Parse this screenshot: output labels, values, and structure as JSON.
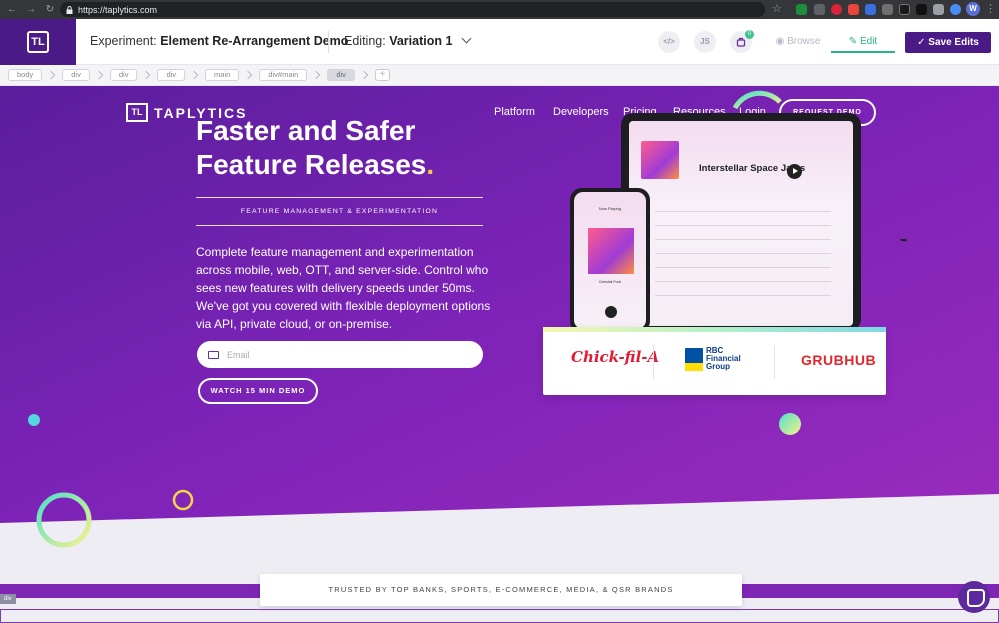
{
  "browser": {
    "url": "https://taplytics.com",
    "profile_initial": "W"
  },
  "editor": {
    "experiment_label": "Experiment:",
    "experiment_name": "Element Re-Arrangement Demo",
    "editing_label": "Editing:",
    "variation": "Variation 1",
    "code_btn": "</>",
    "js_btn": "JS",
    "badge_count": "0",
    "browse_label": "Browse",
    "edit_label": "Edit",
    "save_label": "Save Edits",
    "brand_color": "#4a1b87",
    "accent_color": "#2bb38a"
  },
  "breadcrumb": [
    "body",
    "div",
    "div",
    "div",
    "main",
    "div#main",
    "div"
  ],
  "site": {
    "logo_text": "TAPLYTICS",
    "nav": [
      "Platform",
      "Developers",
      "Pricing",
      "Resources",
      "Login"
    ],
    "request_demo": "REQUEST DEMO",
    "headline_line1": "Faster and Safer",
    "headline_line2": "Feature Releases",
    "headline_dot": ".",
    "subtitle": "FEATURE MANAGEMENT & EXPERIMENTATION",
    "body": "Complete feature management and experimentation across mobile, web, OTT, and server-side. Control who sees new features with delivery speeds under 50ms. We've got you covered with flexible deployment options via API, private cloud, or on-premise.",
    "email_placeholder": "Email",
    "watch_demo": "WATCH 15 MIN DEMO",
    "album_title": "Interstellar Space Jams",
    "phone_title": "Now Playing",
    "phone_track": "Celestial Funk",
    "customer_logos": {
      "chickfila": "Chick-fil-A",
      "rbc_line1": "RBC",
      "rbc_line2": "Financial",
      "rbc_line3": "Group",
      "grubhub": "GRUBHUB"
    },
    "trusted": "TRUSTED BY TOP BANKS, SPORTS, E-COMMERCE, MEDIA, & QSR BRANDS",
    "select_tag": "div"
  }
}
